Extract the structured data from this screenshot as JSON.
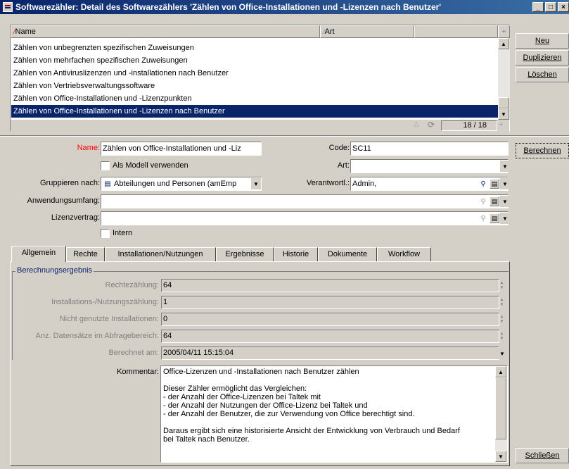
{
  "window": {
    "title": "Softwarezähler: Detail des Softwarezählers 'Zählen von Office-Installationen und -Lizenzen nach Benutzer'",
    "min_label": "_",
    "max_label": "□",
    "close_label": "×"
  },
  "list": {
    "columns": [
      "Name",
      "Art"
    ],
    "rows": [
      "Zählen von unbegrenzten spezifischen Zuweisungen",
      "Zählen von mehrfachen spezifischen Zuweisungen",
      "Zählen von Antiviruslizenzen und -installationen nach Benutzer",
      "Zählen von Vertriebsverwaltungssoftware",
      "Zählen von Office-Installationen und -Lizenzpunkten",
      "Zählen von Office-Installationen und -Lizenzen nach Benutzer"
    ],
    "selected_index": 5,
    "counter": "18 / 18"
  },
  "side_buttons": {
    "neu": "Neu",
    "duplizieren": "Duplizieren",
    "loeschen": "Löschen",
    "berechnen": "Berechnen",
    "schliessen": "Schließen"
  },
  "form": {
    "name_label": "Name:",
    "name_value": "Zählen von Office-Installationen und -Liz",
    "code_label": "Code:",
    "code_value": "SC11",
    "modell_label": "Als Modell verwenden",
    "art_label": "Art:",
    "art_value": "",
    "gruppieren_label": "Gruppieren nach:",
    "gruppieren_value": "Abteilungen und Personen (amEmp",
    "verantwortl_label": "Verantwortl.:",
    "verantwortl_value": "Admin,",
    "anwendungsumfang_label": "Anwendungsumfang:",
    "anwendungsumfang_value": "",
    "lizenzvertrag_label": "Lizenzvertrag:",
    "lizenzvertrag_value": "",
    "intern_label": "Intern"
  },
  "tabs": [
    "Allgemein",
    "Rechte",
    "Installationen/Nutzungen",
    "Ergebnisse",
    "Historie",
    "Dokumente",
    "Workflow"
  ],
  "active_tab": 0,
  "results": {
    "group_label": "Berechnungsergebnis",
    "rows": [
      {
        "label": "Rechtezählung:",
        "value": "64"
      },
      {
        "label": "Installations-/Nutzungszählung:",
        "value": "1"
      },
      {
        "label": "Nicht genutzte Installationen:",
        "value": "0"
      },
      {
        "label": "Anz. Datensätze im Abfragebereich:",
        "value": "64"
      },
      {
        "label": "Berechnet am:",
        "value": "2005/04/11 15:15:04"
      }
    ]
  },
  "kommentar": {
    "label": "Kommentar:",
    "text": "Office-Lizenzen und -Installationen nach Benutzer zählen\n\nDieser Zähler ermöglicht das Vergleichen:\n- der Anzahl der Office-Lizenzen bei Taltek mit\n- der Anzahl der Nutzungen der Office-Lizenz bei Taltek und\n- der Anzahl der Benutzer, die zur Verwendung von Office berechtigt sind.\n\nDaraus ergibt sich eine historisierte Ansicht der Entwicklung von Verbrauch und Bedarf\nbei Taltek nach Benutzer."
  },
  "colors": {
    "titlebar": "#0a246a",
    "selection": "#0a246a",
    "name_label": "#ff0000",
    "window_bg": "#d4d0c8"
  }
}
